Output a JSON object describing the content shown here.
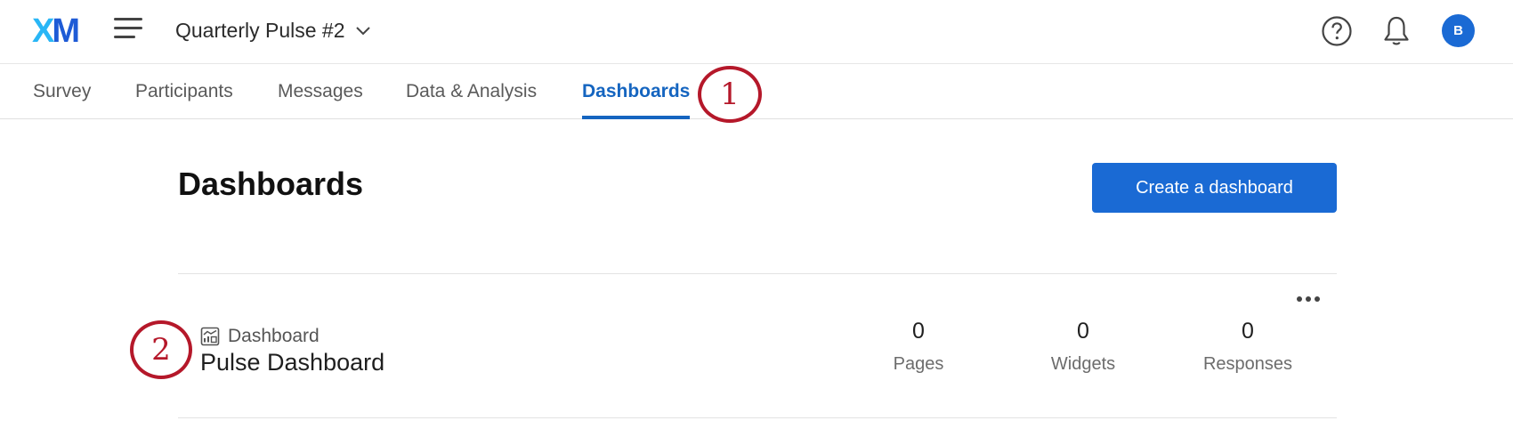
{
  "header": {
    "logo_text": "XM",
    "project_title": "Quarterly Pulse #2",
    "avatar_initial": "B"
  },
  "tabs": [
    {
      "label": "Survey",
      "active": false
    },
    {
      "label": "Participants",
      "active": false
    },
    {
      "label": "Messages",
      "active": false
    },
    {
      "label": "Data & Analysis",
      "active": false
    },
    {
      "label": "Dashboards",
      "active": true
    }
  ],
  "callouts": [
    "1",
    "2"
  ],
  "main": {
    "heading": "Dashboards",
    "create_button": "Create a dashboard",
    "dashboards": [
      {
        "type_label": "Dashboard",
        "name": "Pulse Dashboard",
        "stats": [
          {
            "value": "0",
            "label": "Pages"
          },
          {
            "value": "0",
            "label": "Widgets"
          },
          {
            "value": "0",
            "label": "Responses"
          }
        ]
      }
    ]
  },
  "colors": {
    "accent": "#1a6ad4",
    "active_tab": "#1565c0",
    "callout": "#b5182a",
    "logo_x": "#29b6f6",
    "logo_m": "#1e5bd6"
  },
  "icons": {
    "menu": "hamburger-icon",
    "project_dropdown": "chevron-down-icon",
    "help": "help-icon",
    "notifications": "bell-icon",
    "more": "more-icon",
    "dashboard_type": "chart-icon"
  }
}
